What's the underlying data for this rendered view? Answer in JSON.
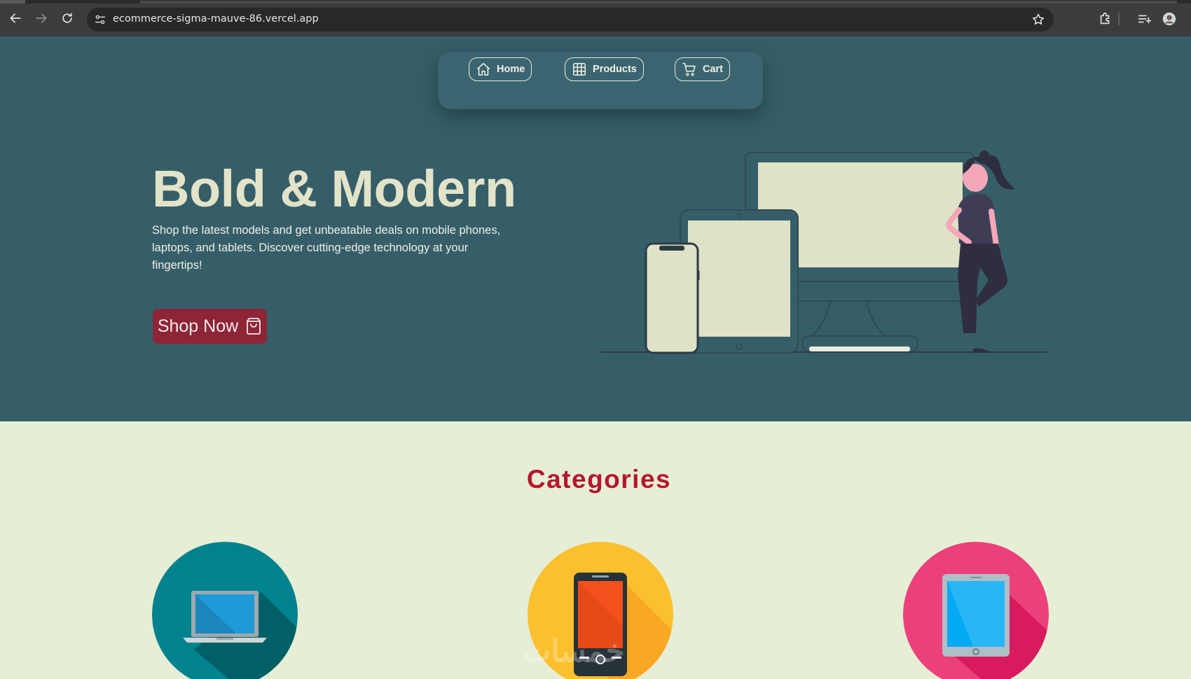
{
  "browser": {
    "url": "ecommerce-sigma-mauve-86.vercel.app",
    "icons": [
      "back-icon",
      "forward-icon",
      "reload-icon",
      "site-info-icon",
      "bookmark-star-icon",
      "extensions-icon",
      "reading-list-icon",
      "profile-icon"
    ]
  },
  "nav": {
    "items": [
      {
        "label": "Home",
        "icon": "home-icon"
      },
      {
        "label": "Products",
        "icon": "grid-icon"
      },
      {
        "label": "Cart",
        "icon": "cart-icon"
      }
    ]
  },
  "hero": {
    "title": "Bold & Modern",
    "description": "Shop the latest models and get unbeatable deals on mobile phones, laptops, and tablets. Discover cutting-edge technology at your fingertips!",
    "cta_label": "Shop Now",
    "cta_icon": "shopping-bag-icon"
  },
  "categories": {
    "title": "Categories",
    "items": [
      {
        "icon": "laptop-icon",
        "color": "#00838f"
      },
      {
        "icon": "mobile-phone-icon",
        "color": "#fbc02d"
      },
      {
        "icon": "tablet-icon",
        "color": "#ec407a"
      }
    ]
  },
  "watermark": "خمسات",
  "colors": {
    "hero_bg": "#365e69",
    "accent_red": "#b5162c",
    "cta_bg": "#8d2537",
    "page_bg": "#e6eed6",
    "title_cream": "#e2e3c8"
  }
}
